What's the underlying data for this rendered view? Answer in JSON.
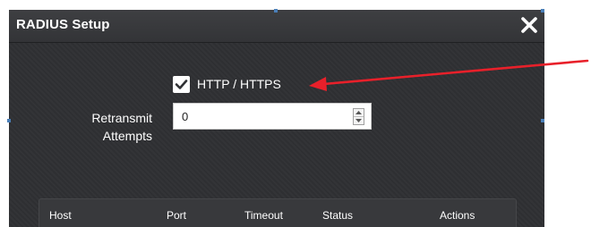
{
  "dialog": {
    "title": "RADIUS Setup",
    "close_icon": "close-icon"
  },
  "form": {
    "http_https": {
      "label": "HTTP / HTTPS",
      "checked": true
    },
    "retransmit": {
      "label_line1": "Retransmit",
      "label_line2": "Attempts",
      "value": "0"
    }
  },
  "table": {
    "headers": [
      "Host",
      "Port",
      "Timeout",
      "Status",
      "Actions"
    ]
  },
  "annotation": {
    "arrow_color": "#e8202a"
  }
}
